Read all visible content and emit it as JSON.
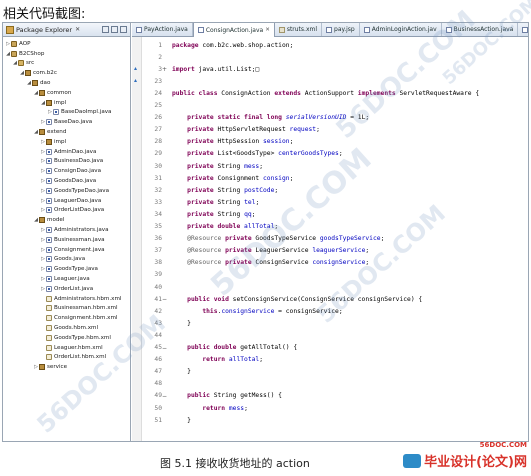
{
  "heading": "相关代码截图:",
  "caption": "图 5.1 接收收货地址的 action",
  "package_explorer": {
    "title": "Package Explorer",
    "items": [
      {
        "label": "AOP",
        "depth": 0,
        "icon": "project-icon",
        "twisty": "▷"
      },
      {
        "label": "B2CShop",
        "depth": 0,
        "icon": "project-icon",
        "twisty": "◢"
      },
      {
        "label": "src",
        "depth": 1,
        "icon": "source-folder-icon",
        "twisty": "◢"
      },
      {
        "label": "com.b2c",
        "depth": 2,
        "icon": "package-icon",
        "twisty": "◢"
      },
      {
        "label": "dao",
        "depth": 3,
        "icon": "package-icon",
        "twisty": "◢"
      },
      {
        "label": "common",
        "depth": 4,
        "icon": "package-icon",
        "twisty": "◢"
      },
      {
        "label": "impl",
        "depth": 5,
        "icon": "package-icon",
        "twisty": "◢"
      },
      {
        "label": "BaseDaoImpl.java",
        "depth": 6,
        "icon": "java-file-icon",
        "twisty": "▷"
      },
      {
        "label": "BaseDao.java",
        "depth": 5,
        "icon": "java-file-icon",
        "twisty": "▷"
      },
      {
        "label": "extend",
        "depth": 4,
        "icon": "package-icon",
        "twisty": "◢"
      },
      {
        "label": "impl",
        "depth": 5,
        "icon": "package-icon",
        "twisty": "▷"
      },
      {
        "label": "AdminDao.java",
        "depth": 5,
        "icon": "java-file-icon",
        "twisty": "▷"
      },
      {
        "label": "BusinessDao.java",
        "depth": 5,
        "icon": "java-file-icon",
        "twisty": "▷"
      },
      {
        "label": "ConsignDao.java",
        "depth": 5,
        "icon": "java-file-icon",
        "twisty": "▷"
      },
      {
        "label": "GoodsDao.java",
        "depth": 5,
        "icon": "java-file-icon",
        "twisty": "▷"
      },
      {
        "label": "GoodsTypeDao.java",
        "depth": 5,
        "icon": "java-file-icon",
        "twisty": "▷"
      },
      {
        "label": "LeaguerDao.java",
        "depth": 5,
        "icon": "java-file-icon",
        "twisty": "▷"
      },
      {
        "label": "OrderListDao.java",
        "depth": 5,
        "icon": "java-file-icon",
        "twisty": "▷"
      },
      {
        "label": "model",
        "depth": 4,
        "icon": "package-icon",
        "twisty": "◢"
      },
      {
        "label": "Administrators.java",
        "depth": 5,
        "icon": "java-file-icon",
        "twisty": "▷"
      },
      {
        "label": "Businessman.java",
        "depth": 5,
        "icon": "java-file-icon",
        "twisty": "▷"
      },
      {
        "label": "Consignment.java",
        "depth": 5,
        "icon": "java-file-icon",
        "twisty": "▷"
      },
      {
        "label": "Goods.java",
        "depth": 5,
        "icon": "java-file-icon",
        "twisty": "▷"
      },
      {
        "label": "GoodsType.java",
        "depth": 5,
        "icon": "java-file-icon",
        "twisty": "▷"
      },
      {
        "label": "Leaguer.java",
        "depth": 5,
        "icon": "java-file-icon",
        "twisty": "▷"
      },
      {
        "label": "OrderList.java",
        "depth": 5,
        "icon": "java-file-icon",
        "twisty": "▷"
      },
      {
        "label": "Administrators.hbm.xml",
        "depth": 5,
        "icon": "xml-file-icon",
        "twisty": ""
      },
      {
        "label": "Businessman.hbm.xml",
        "depth": 5,
        "icon": "xml-file-icon",
        "twisty": ""
      },
      {
        "label": "Consignment.hbm.xml",
        "depth": 5,
        "icon": "xml-file-icon",
        "twisty": ""
      },
      {
        "label": "Goods.hbm.xml",
        "depth": 5,
        "icon": "xml-file-icon",
        "twisty": ""
      },
      {
        "label": "GoodsType.hbm.xml",
        "depth": 5,
        "icon": "xml-file-icon",
        "twisty": ""
      },
      {
        "label": "Leaguer.hbm.xml",
        "depth": 5,
        "icon": "xml-file-icon",
        "twisty": ""
      },
      {
        "label": "OrderList.hbm.xml",
        "depth": 5,
        "icon": "xml-file-icon",
        "twisty": ""
      },
      {
        "label": "service",
        "depth": 4,
        "icon": "package-icon",
        "twisty": "▷"
      }
    ]
  },
  "editor": {
    "tabs": [
      {
        "label": "PayAction.java",
        "icon": "java-file-icon",
        "active": false
      },
      {
        "label": "ConsignAction.java",
        "icon": "java-file-icon",
        "active": true
      },
      {
        "label": "struts.xml",
        "icon": "xml-file-icon",
        "active": false
      },
      {
        "label": "pay.jsp",
        "icon": "jsp-file-icon",
        "active": false
      },
      {
        "label": "AdminLoginAction.jav",
        "icon": "java-file-icon",
        "active": false
      },
      {
        "label": "BusinessAction.java",
        "icon": "java-file-icon",
        "active": false
      },
      {
        "label": "GoodsAction.java",
        "icon": "java-file-icon",
        "active": false
      }
    ],
    "lines": [
      {
        "n": "1",
        "tokens": [
          [
            "kw",
            "package"
          ],
          [
            "src",
            " com.b2c.web.shop.action;"
          ]
        ]
      },
      {
        "n": "2",
        "tokens": []
      },
      {
        "n": "3",
        "fold": "+",
        "tokens": [
          [
            "kw",
            "import"
          ],
          [
            "src",
            " java.util.List;"
          ],
          [
            "src",
            "□"
          ]
        ]
      },
      {
        "n": "23",
        "tokens": []
      },
      {
        "n": "24",
        "tokens": [
          [
            "kw",
            "public class"
          ],
          [
            "src",
            " ConsignAction "
          ],
          [
            "kw",
            "extends"
          ],
          [
            "src",
            " ActionSupport "
          ],
          [
            "kw",
            "implements"
          ],
          [
            "src",
            " ServletRequestAware {"
          ]
        ]
      },
      {
        "n": "25",
        "tokens": []
      },
      {
        "n": "26",
        "tokens": [
          [
            "src",
            "    "
          ],
          [
            "kw",
            "private static final long"
          ],
          [
            "src",
            " "
          ],
          [
            "fldi",
            "serialVersionUID"
          ],
          [
            "src",
            " = 1L;"
          ]
        ]
      },
      {
        "n": "27",
        "tokens": [
          [
            "src",
            "    "
          ],
          [
            "kw",
            "private"
          ],
          [
            "src",
            " HttpServletRequest "
          ],
          [
            "fld",
            "request"
          ],
          [
            "src",
            ";"
          ]
        ]
      },
      {
        "n": "28",
        "tokens": [
          [
            "src",
            "    "
          ],
          [
            "kw",
            "private"
          ],
          [
            "src",
            " HttpSession "
          ],
          [
            "fld",
            "session"
          ],
          [
            "src",
            ";"
          ]
        ]
      },
      {
        "n": "29",
        "tokens": [
          [
            "src",
            "    "
          ],
          [
            "kw",
            "private"
          ],
          [
            "src",
            " List<GoodsType> "
          ],
          [
            "fld",
            "centerGoodsTypes"
          ],
          [
            "src",
            ";"
          ]
        ]
      },
      {
        "n": "30",
        "tokens": [
          [
            "src",
            "    "
          ],
          [
            "kw",
            "private"
          ],
          [
            "src",
            " String "
          ],
          [
            "fld",
            "mess"
          ],
          [
            "src",
            ";"
          ]
        ]
      },
      {
        "n": "31",
        "tokens": [
          [
            "src",
            "    "
          ],
          [
            "kw",
            "private"
          ],
          [
            "src",
            " Consignment "
          ],
          [
            "fld",
            "consign"
          ],
          [
            "src",
            ";"
          ]
        ]
      },
      {
        "n": "32",
        "tokens": [
          [
            "src",
            "    "
          ],
          [
            "kw",
            "private"
          ],
          [
            "src",
            " String "
          ],
          [
            "fld",
            "postCode"
          ],
          [
            "src",
            ";"
          ]
        ]
      },
      {
        "n": "33",
        "tokens": [
          [
            "src",
            "    "
          ],
          [
            "kw",
            "private"
          ],
          [
            "src",
            " String "
          ],
          [
            "fld",
            "tel"
          ],
          [
            "src",
            ";"
          ]
        ]
      },
      {
        "n": "34",
        "tokens": [
          [
            "src",
            "    "
          ],
          [
            "kw",
            "private"
          ],
          [
            "src",
            " String "
          ],
          [
            "fld",
            "qq"
          ],
          [
            "src",
            ";"
          ]
        ]
      },
      {
        "n": "35",
        "tokens": [
          [
            "src",
            "    "
          ],
          [
            "kw",
            "private double"
          ],
          [
            "src",
            " "
          ],
          [
            "fld",
            "allTotal"
          ],
          [
            "src",
            ";"
          ]
        ]
      },
      {
        "n": "36",
        "tokens": [
          [
            "src",
            "    "
          ],
          [
            "ann",
            "@Resource"
          ],
          [
            "src",
            " "
          ],
          [
            "kw",
            "private"
          ],
          [
            "src",
            " GoodsTypeService "
          ],
          [
            "fld",
            "goodsTypeService"
          ],
          [
            "src",
            ";"
          ]
        ]
      },
      {
        "n": "37",
        "tokens": [
          [
            "src",
            "    "
          ],
          [
            "ann",
            "@Resource"
          ],
          [
            "src",
            " "
          ],
          [
            "kw",
            "private"
          ],
          [
            "src",
            " LeaguerService "
          ],
          [
            "fld",
            "leaguerService"
          ],
          [
            "src",
            ";"
          ]
        ]
      },
      {
        "n": "38",
        "tokens": [
          [
            "src",
            "    "
          ],
          [
            "ann",
            "@Resource"
          ],
          [
            "src",
            " "
          ],
          [
            "kw",
            "private"
          ],
          [
            "src",
            " ConsignService "
          ],
          [
            "fld",
            "consignService"
          ],
          [
            "src",
            ";"
          ]
        ]
      },
      {
        "n": "39",
        "tokens": []
      },
      {
        "n": "40",
        "tokens": []
      },
      {
        "n": "41",
        "fold": "−",
        "tokens": [
          [
            "src",
            "    "
          ],
          [
            "kw",
            "public void"
          ],
          [
            "src",
            " setConsignService(ConsignService consignService) {"
          ]
        ]
      },
      {
        "n": "42",
        "tokens": [
          [
            "src",
            "        "
          ],
          [
            "kw",
            "this"
          ],
          [
            "src",
            "."
          ],
          [
            "fld",
            "consignService"
          ],
          [
            "src",
            " = consignService;"
          ]
        ]
      },
      {
        "n": "43",
        "tokens": [
          [
            "src",
            "    }"
          ]
        ]
      },
      {
        "n": "44",
        "tokens": []
      },
      {
        "n": "45",
        "fold": "−",
        "tokens": [
          [
            "src",
            "    "
          ],
          [
            "kw",
            "public double"
          ],
          [
            "src",
            " getAllTotal() {"
          ]
        ]
      },
      {
        "n": "46",
        "tokens": [
          [
            "src",
            "        "
          ],
          [
            "kw",
            "return"
          ],
          [
            "src",
            " "
          ],
          [
            "fld",
            "allTotal"
          ],
          [
            "src",
            ";"
          ]
        ]
      },
      {
        "n": "47",
        "tokens": [
          [
            "src",
            "    }"
          ]
        ]
      },
      {
        "n": "48",
        "tokens": []
      },
      {
        "n": "49",
        "fold": "−",
        "tokens": [
          [
            "src",
            "    "
          ],
          [
            "kw",
            "public"
          ],
          [
            "src",
            " String getMess() {"
          ]
        ]
      },
      {
        "n": "50",
        "tokens": [
          [
            "src",
            "        "
          ],
          [
            "kw",
            "return"
          ],
          [
            "src",
            " "
          ],
          [
            "fld",
            "mess"
          ],
          [
            "src",
            ";"
          ]
        ]
      },
      {
        "n": "51",
        "tokens": [
          [
            "src",
            "    }"
          ]
        ]
      }
    ]
  },
  "watermark": {
    "text": "56DOC.COM",
    "logo_url": "56DOC.COM",
    "logo_text": "毕业设计(论文)网"
  }
}
